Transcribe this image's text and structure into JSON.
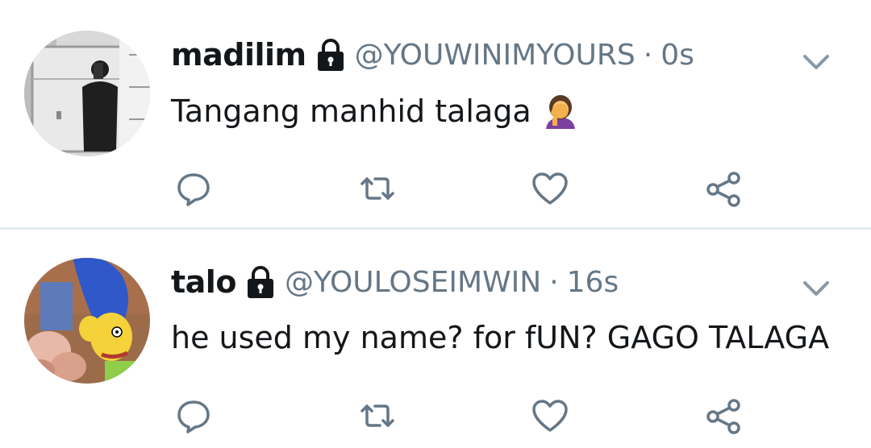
{
  "colors": {
    "text_primary": "#14171a",
    "text_secondary": "#657786",
    "divider": "#e6ecf0"
  },
  "tweets": [
    {
      "display_name": "madilim",
      "handle": "@YOUWINIMYOURS",
      "separator": "·",
      "time": "0s",
      "text": "Tangang manhid talaga",
      "emoji": "woman-facepalming-emoji",
      "protected_icon": "lock-icon"
    },
    {
      "display_name": "talo",
      "handle": "@YOULOSEIMWIN",
      "separator": "·",
      "time": "16s",
      "text": "he used my name? for fUN? GAGO TALAGA",
      "protected_icon": "lock-icon"
    }
  ],
  "action_icons": [
    "reply-icon",
    "retweet-icon",
    "like-icon",
    "share-icon"
  ]
}
